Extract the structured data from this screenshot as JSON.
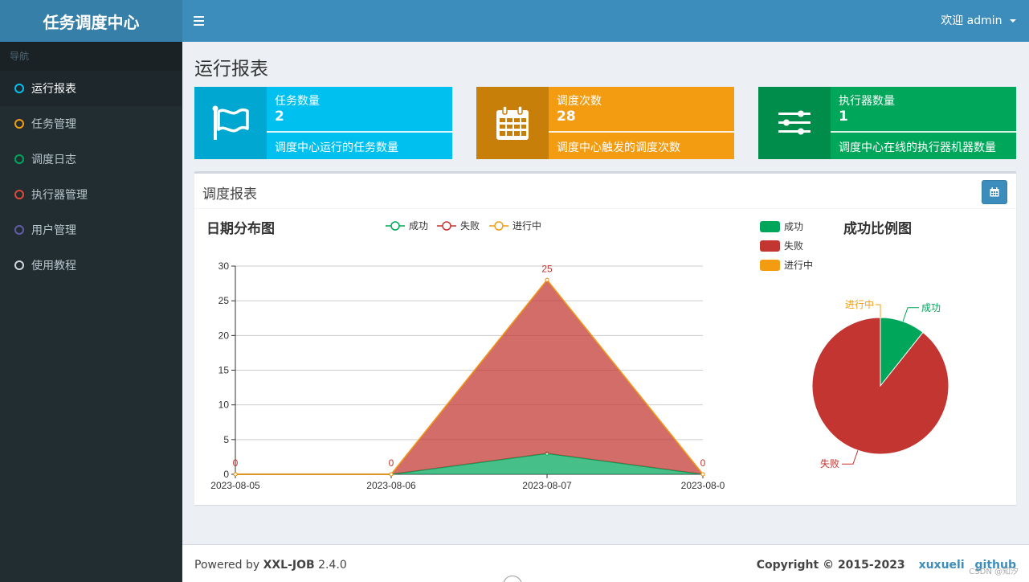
{
  "app": {
    "logo": "任务调度中心"
  },
  "sidebar": {
    "header": "导航",
    "items": [
      {
        "label": "运行报表",
        "color": "#00c0ef"
      },
      {
        "label": "任务管理",
        "color": "#f39c12"
      },
      {
        "label": "调度日志",
        "color": "#00a65a"
      },
      {
        "label": "执行器管理",
        "color": "#dd4b39"
      },
      {
        "label": "用户管理",
        "color": "#605ca8"
      },
      {
        "label": "使用教程",
        "color": "#d2d6de"
      }
    ]
  },
  "header": {
    "welcome": "欢迎 admin",
    "menu_icon": "hamburger-icon"
  },
  "page": {
    "title": "运行报表"
  },
  "cards": [
    {
      "title": "任务数量",
      "number": "2",
      "desc": "调度中心运行的任务数量",
      "icon": "flag-icon",
      "color": "#00c0ef",
      "icon_bg": "#00a7d0"
    },
    {
      "title": "调度次数",
      "number": "28",
      "desc": "调度中心触发的调度次数",
      "icon": "calendar-icon",
      "color": "#f39c12",
      "icon_bg": "#c87f0a"
    },
    {
      "title": "执行器数量",
      "number": "1",
      "desc": "调度中心在线的执行器机器数量",
      "icon": "sliders-icon",
      "color": "#00a65a",
      "icon_bg": "#008d4c"
    }
  ],
  "report": {
    "title": "调度报表"
  },
  "footer": {
    "powered_prefix": "Powered by ",
    "powered_brand": "XXL-JOB",
    "version": " 2.4.0",
    "copyright": "Copyright © 2015-2023",
    "link1": "xuxueli",
    "link2": "github",
    "watermark": "CSDN @知汐"
  },
  "chart_data": [
    {
      "type": "area",
      "title": "日期分布图",
      "categories": [
        "2023-08-05",
        "2023-08-06",
        "2023-08-07",
        "2023-08-0"
      ],
      "legend": [
        "成功",
        "失败",
        "进行中"
      ],
      "series": [
        {
          "name": "成功",
          "values": [
            0,
            0,
            3,
            0
          ],
          "color": "#00a65a"
        },
        {
          "name": "失败",
          "values": [
            0,
            0,
            25,
            0
          ],
          "color": "#c23531"
        },
        {
          "name": "进行中",
          "values": [
            0,
            0,
            0,
            0
          ],
          "color": "#f39c12"
        }
      ],
      "data_labels": [
        "0",
        "0",
        "25",
        "0"
      ],
      "ylim": [
        0,
        30
      ],
      "yticks": [
        0,
        5,
        10,
        15,
        20,
        25,
        30
      ],
      "stacked": true,
      "grid": true
    },
    {
      "type": "pie",
      "title": "成功比例图",
      "legend": [
        "成功",
        "失败",
        "进行中"
      ],
      "legend_position": "top-left",
      "slices": [
        {
          "label": "成功",
          "value": 3,
          "color": "#00a65a"
        },
        {
          "label": "失败",
          "value": 25,
          "color": "#c23531"
        },
        {
          "label": "进行中",
          "value": 0,
          "color": "#f39c12"
        }
      ]
    }
  ]
}
